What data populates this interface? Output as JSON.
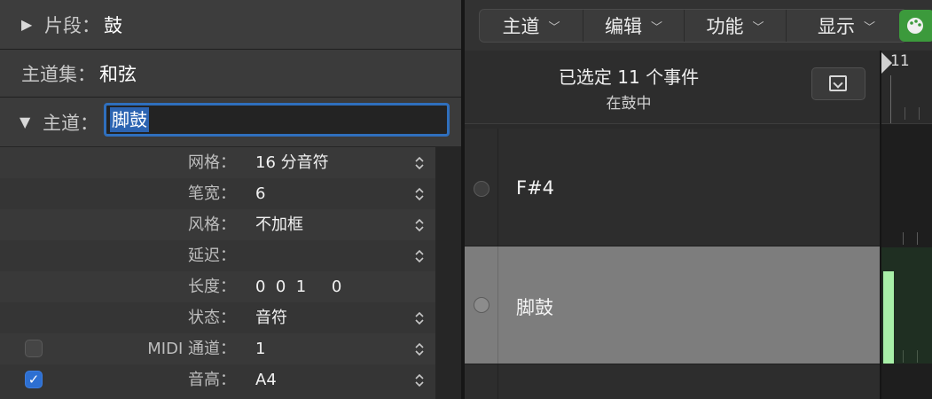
{
  "inspector": {
    "segment": {
      "label": "片段：",
      "value": "鼓"
    },
    "track_set": {
      "label": "主道集：",
      "value": "和弦"
    },
    "main_track": {
      "label": "主道：",
      "value": "脚鼓"
    },
    "params": [
      {
        "label": "网格：",
        "value": "16 分音符",
        "stepper": true
      },
      {
        "label": "笔宽：",
        "value": "6",
        "stepper": true
      },
      {
        "label": "风格：",
        "value": "不加框",
        "stepper": true
      },
      {
        "label": "延迟：",
        "value": "",
        "stepper": true
      },
      {
        "label": "长度：",
        "value": "0  0  1     0",
        "stepper": false
      },
      {
        "label": "状态：",
        "value": "音符",
        "stepper": true
      },
      {
        "label": "MIDI 通道：",
        "value": "1",
        "stepper": true,
        "checkbox": false
      },
      {
        "label": "音高：",
        "value": "A4",
        "stepper": true,
        "checkbox": true
      }
    ]
  },
  "toolbar": {
    "menus": [
      "主道",
      "编辑",
      "功能",
      "显示"
    ],
    "accent": "#3c9a3c"
  },
  "header": {
    "title": "已选定 11 个事件",
    "subtitle": "在鼓中"
  },
  "tracks": [
    {
      "name": "F#4"
    },
    {
      "name": "脚鼓"
    }
  ],
  "ruler": {
    "bar_number": "11"
  }
}
